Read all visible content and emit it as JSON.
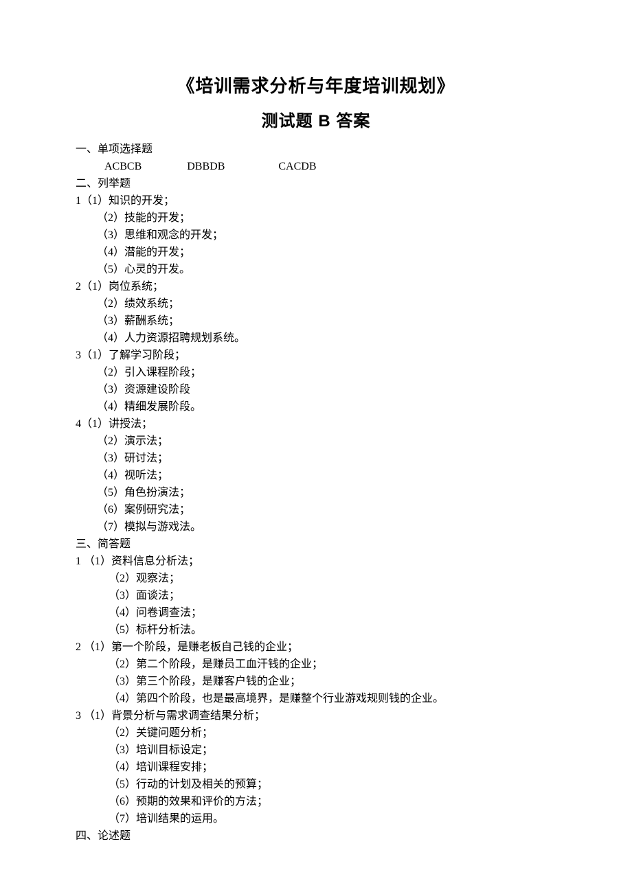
{
  "title_main": "《培训需求分析与年度培训规划》",
  "title_sub": "测试题 B 答案",
  "section1": {
    "heading": "一、单项选择题",
    "answers": [
      "ACBCB",
      "DBBDB",
      "CACDB"
    ]
  },
  "section2": {
    "heading": "二、列举题",
    "q1": [
      "1（1）知识的开发；",
      "（2）技能的开发；",
      "（3）思维和观念的开发；",
      "（4）潜能的开发；",
      "（5）心灵的开发。"
    ],
    "q2": [
      "2（1）岗位系统；",
      "（2）绩效系统；",
      "（3）薪酬系统；",
      "（4）人力资源招聘规划系统。"
    ],
    "q3": [
      "3（1）了解学习阶段；",
      "（2）引入课程阶段；",
      "（3）资源建设阶段",
      "（4）精细发展阶段。"
    ],
    "q4": [
      "4（1）讲授法；",
      "（2）演示法；",
      "（3）研讨法；",
      "（4）视听法；",
      "（5）角色扮演法；",
      "（6）案例研究法；",
      "（7）模拟与游戏法。"
    ]
  },
  "section3": {
    "heading": "三、简答题",
    "q1": [
      "1 （1）资料信息分析法；",
      "（2）观察法；",
      "（3）面谈法；",
      "（4）问卷调查法；",
      "（5）标杆分析法。"
    ],
    "q2": [
      "2 （1）第一个阶段，是赚老板自己钱的企业；",
      "（2）第二个阶段，是赚员工血汗钱的企业；",
      "（3）第三个阶段，是赚客户钱的企业；",
      "（4）第四个阶段，也是最高境界，是赚整个行业游戏规则钱的企业。"
    ],
    "q3": [
      "3 （1）背景分析与需求调查结果分析；",
      "（2）关键问题分析；",
      "（3）培训目标设定；",
      "（4）培训课程安排；",
      "（5）行动的计划及相关的预算；",
      "（6）预期的效果和评价的方法；",
      "（7）培训结果的运用。"
    ]
  },
  "section4": {
    "heading": "四、论述题"
  }
}
